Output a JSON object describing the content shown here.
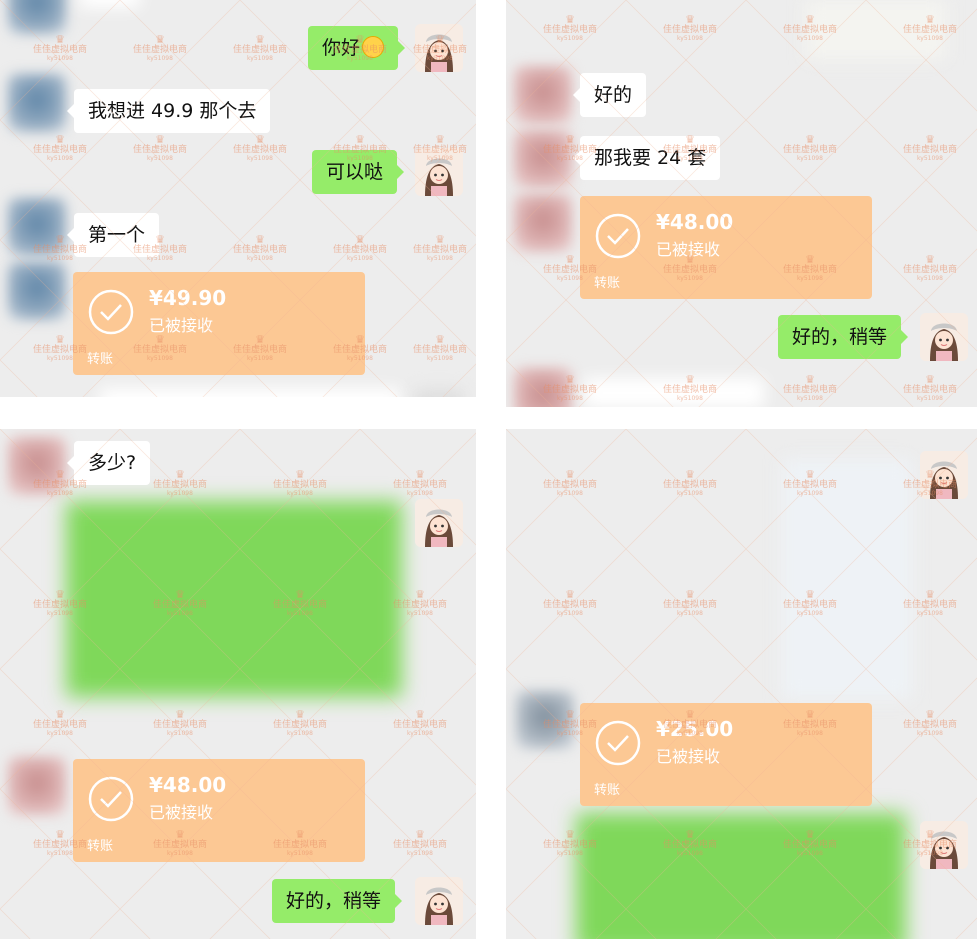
{
  "watermark": {
    "name": "佳佳虚拟电商",
    "sub": "ky51098",
    "crown": "♛"
  },
  "transfer_label": "转账",
  "panels": [
    {
      "messages": [
        {
          "side": "right",
          "text": "你好",
          "emoji": "smiling-face-emoji"
        },
        {
          "side": "left",
          "text": "我想进 49.9 那个去"
        },
        {
          "side": "right",
          "text": "可以哒"
        },
        {
          "side": "left",
          "text": "第一个"
        },
        {
          "side": "left",
          "type": "transfer",
          "amount": "¥49.90",
          "status": "已被接收"
        }
      ]
    },
    {
      "messages": [
        {
          "side": "left",
          "text": "好的"
        },
        {
          "side": "left",
          "text": "那我要 24 套"
        },
        {
          "side": "left",
          "type": "transfer",
          "amount": "¥48.00",
          "status": "已被接收"
        },
        {
          "side": "right",
          "text": "好的，稍等"
        }
      ]
    },
    {
      "messages": [
        {
          "side": "left",
          "text": "多少?"
        },
        {
          "side": "right",
          "type": "blurred-image"
        },
        {
          "side": "left",
          "type": "transfer",
          "amount": "¥48.00",
          "status": "已被接收"
        },
        {
          "side": "right",
          "text": "好的，稍等"
        }
      ]
    },
    {
      "messages": [
        {
          "side": "left",
          "type": "blurred-image"
        },
        {
          "side": "left",
          "type": "transfer",
          "amount": "¥25.00",
          "status": "已被接收"
        },
        {
          "side": "right",
          "type": "blurred-image"
        }
      ]
    }
  ],
  "colors": {
    "chat_background": "#ededed",
    "bubble_green": "#95ec69",
    "bubble_white": "#ffffff",
    "transfer_orange": "#fcc894",
    "watermark": "#e88c64"
  }
}
